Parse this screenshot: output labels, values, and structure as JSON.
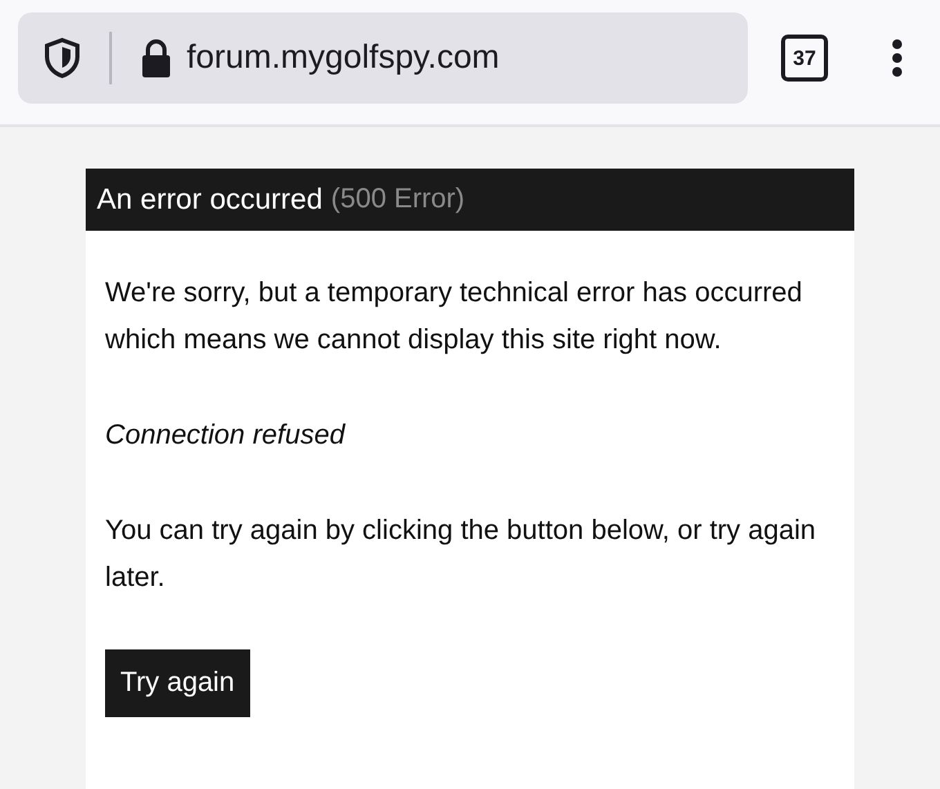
{
  "browser": {
    "url": "forum.mygolfspy.com",
    "tab_count": "37"
  },
  "error": {
    "title": "An error occurred",
    "code": "(500 Error)",
    "paragraphs": [
      {
        "kind": "text",
        "text": "We're sorry, but a temporary technical error has occurred which means we cannot display this site right now."
      },
      {
        "kind": "italic",
        "text": "Connection refused"
      },
      {
        "kind": "text",
        "text": "You can try again by clicking the button below, or try again later."
      }
    ],
    "button": "Try again"
  }
}
